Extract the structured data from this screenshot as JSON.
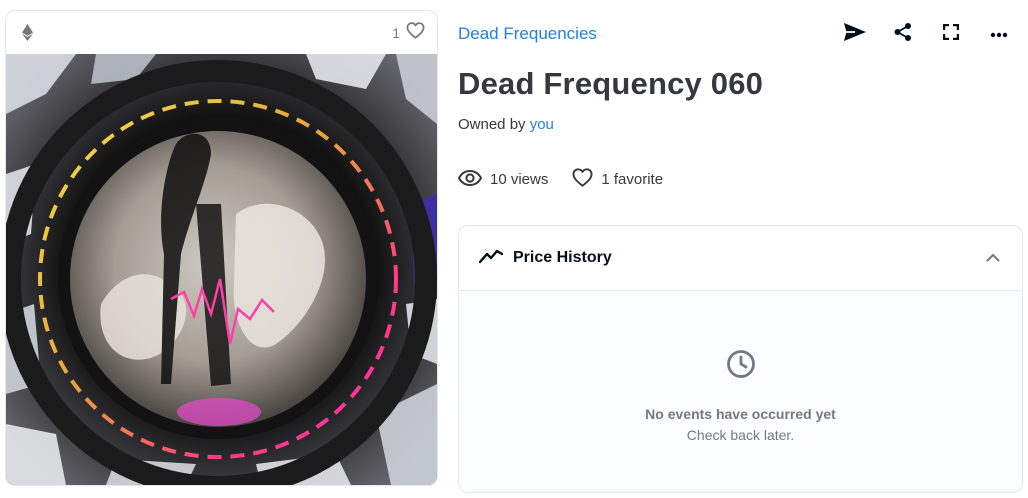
{
  "media": {
    "favorite_count": "1",
    "chain_icon": "ethereum-icon",
    "favorite_icon": "heart-outline-icon"
  },
  "collection": {
    "name": "Dead Frequencies"
  },
  "actions": {
    "icons": [
      "send-icon",
      "share-icon",
      "fullscreen-icon",
      "more-icon"
    ]
  },
  "item": {
    "title": "Dead Frequency 060",
    "owned_by_label": "Owned by",
    "owner": "you"
  },
  "stats": {
    "views": "10 views",
    "favorites": "1 favorite"
  },
  "price_history": {
    "title": "Price History",
    "empty_title": "No events have occurred yet",
    "empty_subtitle": "Check back later."
  },
  "colors": {
    "link": "#2081e2",
    "text_dark": "#353840",
    "muted": "#707a83",
    "border": "#e5e8eb"
  }
}
